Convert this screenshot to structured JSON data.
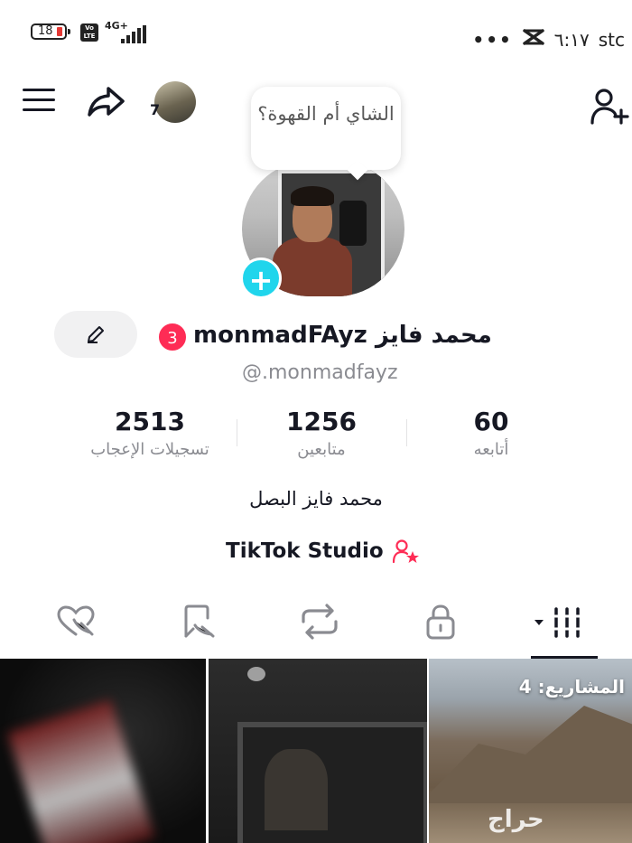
{
  "status_bar": {
    "battery": "18",
    "volte": "Vo LTE",
    "network": "4G+",
    "time": "٦:١٧",
    "carrier": "stc",
    "more": "•••"
  },
  "header": {
    "friends_count": "7"
  },
  "profile": {
    "bubble_note": "الشاي أم القهوة؟",
    "name": "محمد فايز monmadFAyz",
    "badge_count": "3",
    "handle": "@.monmadfayz",
    "bio": "محمد فايز البصل",
    "studio_label": "TikTok Studio"
  },
  "stats": {
    "likes": {
      "value": "2513",
      "label": "تسجيلات الإعجاب"
    },
    "followers": {
      "value": "1256",
      "label": "متابعين"
    },
    "following": {
      "value": "60",
      "label": "أتابعه"
    }
  },
  "tabs": {
    "icons": [
      "liked-hidden-icon",
      "favorites-hidden-icon",
      "repost-icon",
      "private-lock-icon",
      "videos-grid-icon"
    ],
    "active": "videos-grid-icon"
  },
  "grid": {
    "drafts_label": "المشاريع: 4",
    "watermark": "حراج"
  },
  "colors": {
    "accent_pink": "#fe2c55",
    "story_add": "#20d5ec",
    "text_primary": "#161823",
    "text_secondary": "#8a8b91"
  }
}
